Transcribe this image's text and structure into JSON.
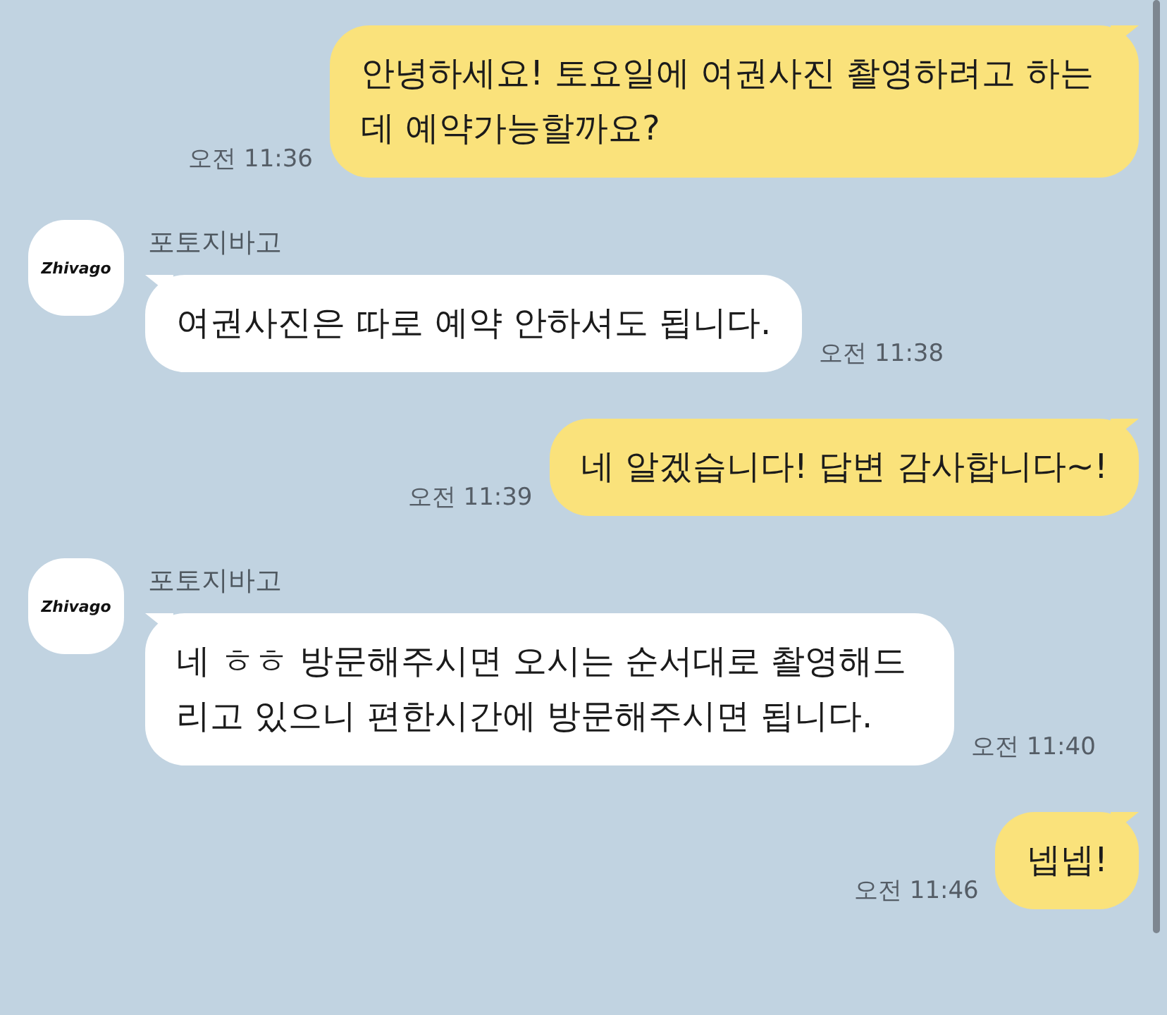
{
  "messages": [
    {
      "kind": "sent",
      "text": "안녕하세요! 토요일에 여권사진 촬영하려고 하는데 예약가능할까요?",
      "time": "오전 11:36"
    },
    {
      "kind": "received",
      "sender": "포토지바고",
      "avatar_logo": "Zhivago",
      "text": "여권사진은 따로 예약 안하셔도 됩니다.",
      "time": "오전 11:38"
    },
    {
      "kind": "sent",
      "text": "네 알겠습니다! 답변 감사합니다~!",
      "time": "오전 11:39"
    },
    {
      "kind": "received",
      "sender": "포토지바고",
      "avatar_logo": "Zhivago",
      "text": "네 ㅎㅎ 방문해주시면 오시는 순서대로 촬영해드리고 있으니 편한시간에 방문해주시면 됩니다.",
      "time": "오전 11:40"
    },
    {
      "kind": "sent",
      "text": "넵넵!",
      "time": "오전 11:46"
    }
  ]
}
